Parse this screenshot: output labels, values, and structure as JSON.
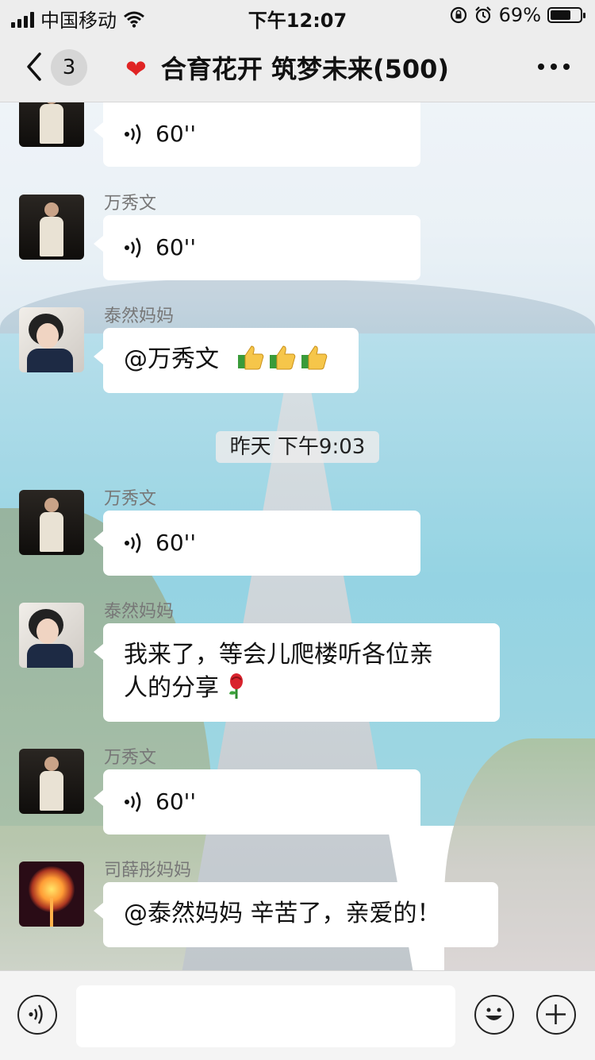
{
  "status_bar": {
    "carrier": "中国移动",
    "time": "下午12:07",
    "battery_percent": "69%",
    "battery_level": 0.69
  },
  "nav": {
    "back_count": "3",
    "heart_icon": "❤",
    "title": "合育花开 筑梦未来(500)"
  },
  "messages": [
    {
      "sender": "",
      "type": "voice",
      "duration": "60''"
    },
    {
      "sender": "万秀文",
      "type": "voice",
      "duration": "60''"
    },
    {
      "sender": "泰然妈妈",
      "type": "text",
      "text": "@万秀文"
    },
    {
      "separator": "昨天 下午9:03"
    },
    {
      "sender": "万秀文",
      "type": "voice",
      "duration": "60''"
    },
    {
      "sender": "泰然妈妈",
      "type": "text",
      "text_line1": "我来了，等会儿爬楼听各位亲",
      "text_line2": "人的分享"
    },
    {
      "sender": "万秀文",
      "type": "voice",
      "duration": "60''"
    },
    {
      "sender": "司薛彤妈妈",
      "type": "text",
      "text": "@泰然妈妈 辛苦了，亲爱的！"
    }
  ],
  "icons": {
    "voice": "voice-wave-icon",
    "thumbs_up": "thumbs-up-emoji",
    "rose": "rose-emoji",
    "emoji": "smiley-icon",
    "plus": "plus-icon"
  },
  "colors": {
    "bar_bg": "#ededed",
    "bubble": "#ffffff",
    "heart": "#e02424"
  }
}
